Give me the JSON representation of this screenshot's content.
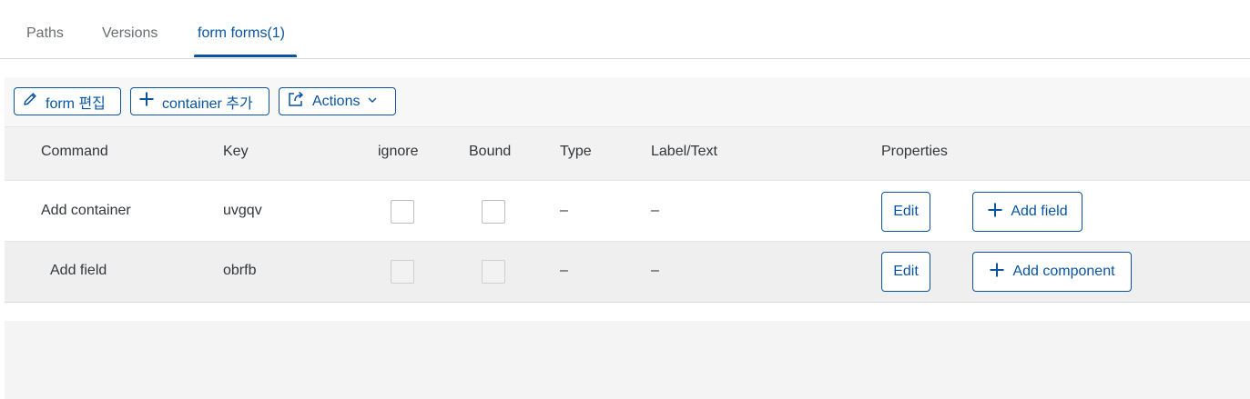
{
  "tabs": [
    {
      "label": "Paths",
      "active": false
    },
    {
      "label": "Versions",
      "active": false
    },
    {
      "label": "form forms(1)",
      "active": true
    }
  ],
  "toolbar": {
    "edit_form_label": "form 편집",
    "add_container_label": "container 추가",
    "actions_label": "Actions"
  },
  "table": {
    "columns": [
      "Command",
      "Key",
      "ignore",
      "Bound",
      "Type",
      "Label/Text",
      "Properties"
    ],
    "rows": [
      {
        "command": "Add container",
        "key": "uvgqv",
        "ignore": false,
        "bound": false,
        "type": "–",
        "label": "–",
        "edit_label": "Edit",
        "add_label": "Add field"
      },
      {
        "command": "Add field",
        "key": "obrfb",
        "ignore": false,
        "bound": false,
        "type": "–",
        "label": "–",
        "edit_label": "Edit",
        "add_label": "Add component"
      }
    ]
  },
  "colors": {
    "accent": "#0854a0",
    "header_bg": "#f2f2f2",
    "text": "#32363a"
  },
  "icons": [
    "pencil-icon",
    "plus-icon",
    "share-icon",
    "chevron-down-icon"
  ]
}
